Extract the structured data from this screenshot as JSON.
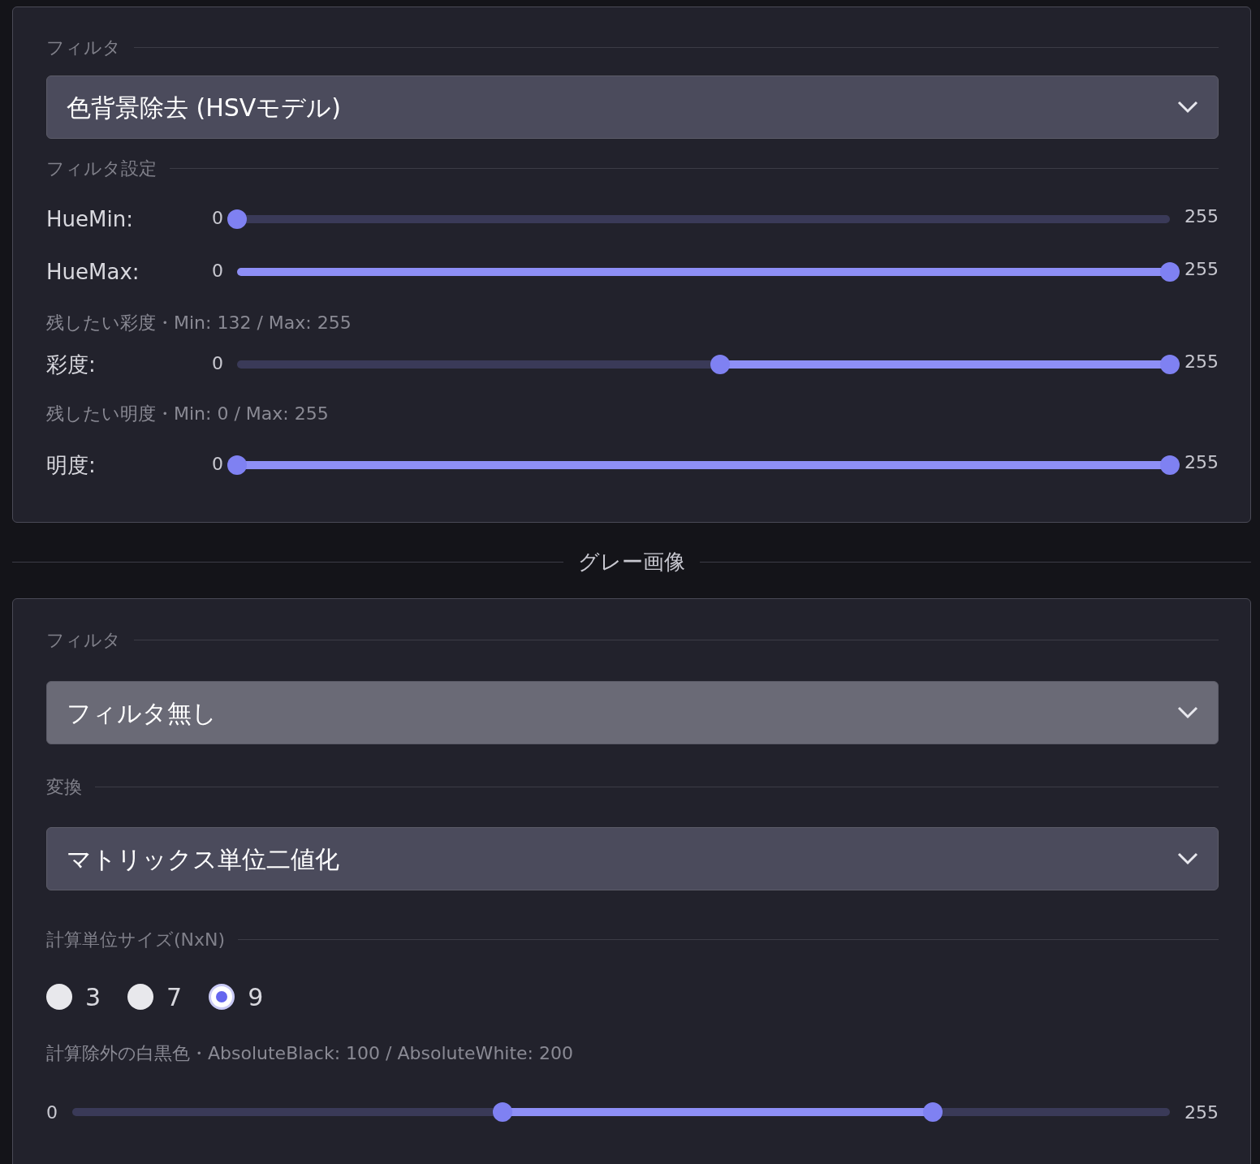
{
  "panels": [
    {
      "blocks": [
        {
          "kind": "legend",
          "text": "フィルタ"
        },
        {
          "kind": "select",
          "value": "色背景除去 (HSVモデル)",
          "highlighted": false
        },
        {
          "kind": "legend",
          "text": "フィルタ設定"
        },
        {
          "kind": "slider",
          "label": "HueMin:",
          "min": "0",
          "max": "255",
          "thumbs": [
            {
              "level": 0
            }
          ]
        },
        {
          "kind": "slider",
          "label": "HueMax:",
          "min": "0",
          "max": "255",
          "thumbs": [
            {
              "level": 1
            }
          ]
        },
        {
          "kind": "caption",
          "text": "残したい彩度・Min: 132 / Max: 255"
        },
        {
          "kind": "slider",
          "label": "彩度:",
          "min": "0",
          "max": "255",
          "thumbs": [
            {
              "level": 0.518
            },
            {
              "level": 1
            }
          ]
        },
        {
          "kind": "caption",
          "text": "残したい明度・Min: 0 / Max: 255"
        },
        {
          "kind": "slider",
          "label": "明度:",
          "min": "0",
          "max": "255",
          "thumbs": [
            {
              "level": 0
            },
            {
              "level": 1
            }
          ]
        }
      ]
    },
    {
      "divider": "グレー画像",
      "blocks": [
        {
          "kind": "legend",
          "text": "フィルタ"
        },
        {
          "kind": "select",
          "value": "フィルタ無し",
          "highlighted": true
        },
        {
          "kind": "legend",
          "text": "変換"
        },
        {
          "kind": "select",
          "value": "マトリックス単位二値化",
          "highlighted": false
        },
        {
          "kind": "legend",
          "text": "計算単位サイズ(NxN)"
        },
        {
          "kind": "radios",
          "options": [
            {
              "label": "3",
              "selected": false
            },
            {
              "label": "7",
              "selected": false
            },
            {
              "label": "9",
              "selected": true
            }
          ]
        },
        {
          "kind": "caption",
          "text": "計算除外の白黒色・AbsoluteBlack: 100 / AbsoluteWhite: 200"
        },
        {
          "kind": "slider",
          "min": "0",
          "max": "255",
          "thumbs": [
            {
              "level": 0.392
            },
            {
              "level": 0.784
            }
          ]
        }
      ]
    }
  ]
}
